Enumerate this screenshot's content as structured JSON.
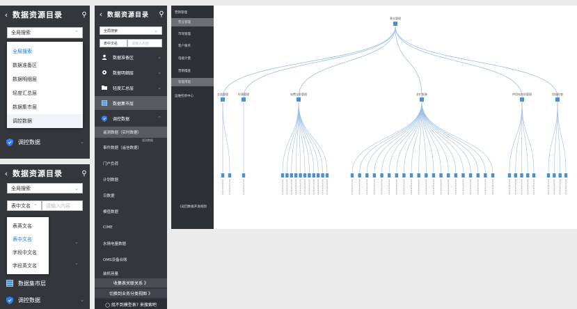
{
  "colors": {
    "panel_bg": "#33363b",
    "active_row": "#585b60",
    "accent_blue": "#1677ff",
    "tree_node": "#4a90d9",
    "tree_link": "#9dc0e6",
    "shield_blue": "#2e7cf6"
  },
  "panel1": {
    "back_icon": "chevron-left",
    "title": "数据资源目录",
    "search_icon": "search",
    "scope_select": "全局搜索",
    "dropdown": [
      "全局搜索",
      "数据准备区",
      "数据明细层",
      "轻度汇总层",
      "数据集市层",
      "调控数据"
    ],
    "selected_option": "全局搜索",
    "row_label": "调控数据"
  },
  "panel2": {
    "back_icon": "chevron-left",
    "title": "数据资源目录",
    "search_icon": "search",
    "scope_select": "全局搜索",
    "field_select": "表中文名",
    "input_placeholder": "请输入内容",
    "dropdown": [
      "表英文名",
      "表中文名",
      "字段中文名",
      "字段英文名"
    ],
    "selected_option": "表中文名",
    "rows": [
      "数据集市层",
      "调控数据"
    ]
  },
  "panel3": {
    "back_icon": "chevron-left",
    "title": "数据资源目录",
    "search_icon": "search",
    "scope_select": "全局搜索",
    "field_select": "表中文名",
    "input_placeholder": "请输入内容",
    "categories": [
      "数据准备区",
      "数据明细层",
      "轻度汇总层",
      "数据集市层",
      "调控数据"
    ],
    "active_category": "数据集市层",
    "sub_items": [
      "遥测数据（实时数据）",
      "事件数据（遥信数据）",
      "门户负荷",
      "计划数据",
      "日数据",
      "模值数据",
      "CIME",
      "水情电量数据",
      "OMS设备台账",
      "装机容量"
    ],
    "tooltip": "遥测数据",
    "buttons": [
      "收集表关联关系 》",
      "切换到业务分类视图 》",
      "◯ 找不到模型表? 来搜索吧"
    ]
  },
  "right": {
    "nav": [
      {
        "label": "营销管理",
        "level": 0
      },
      {
        "label": "营业管理",
        "level": 1,
        "active": true
      },
      {
        "label": "市场管理",
        "level": 1
      },
      {
        "label": "客户服务",
        "level": 1
      },
      {
        "label": "电能计量",
        "level": 1
      },
      {
        "label": "营销稽查",
        "level": 1
      },
      {
        "label": "智能用电",
        "level": 1
      },
      {
        "label": "运维检修中心",
        "level": 0
      }
    ],
    "footer": "《返回数据开发视图",
    "tree_root": "营业管理",
    "tree_children": [
      "业务管理",
      "抄表管理",
      "电费业务管理",
      "业扩报装",
      "供用电合同管理",
      "用电检查"
    ],
    "leaf_counts": [
      2,
      1,
      11,
      20,
      5,
      4
    ]
  }
}
